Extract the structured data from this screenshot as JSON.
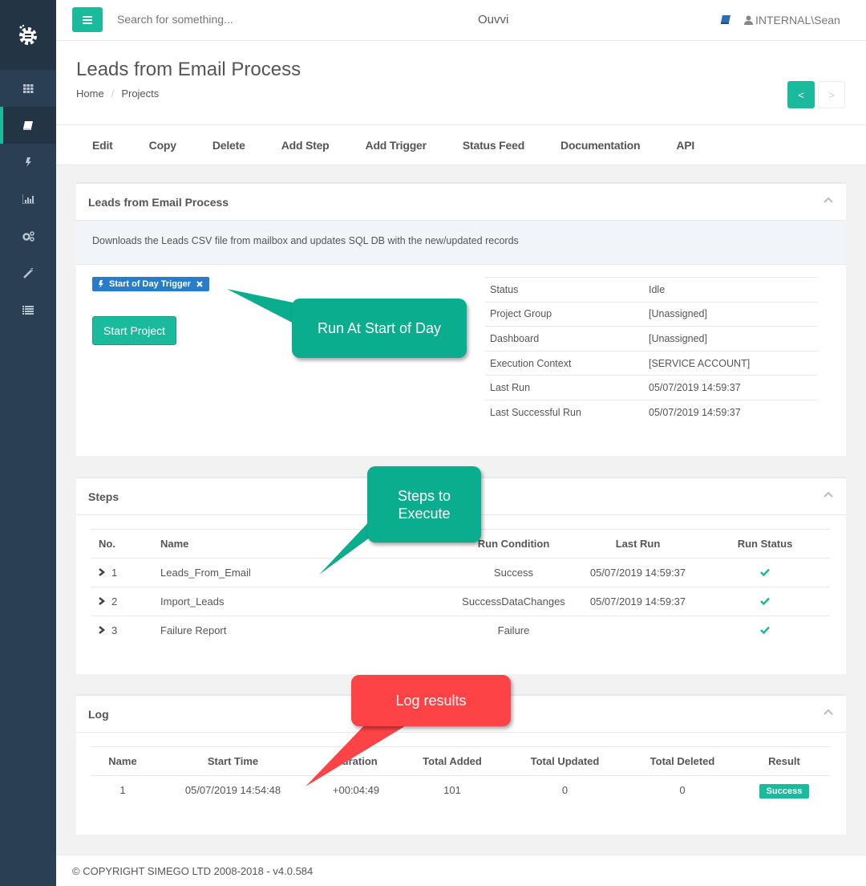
{
  "app": {
    "title": "Ouvvi"
  },
  "topbar": {
    "search_placeholder": "Search for something...",
    "user": "INTERNAL\\Sean"
  },
  "sidebar": {
    "items": [
      {
        "icon": "grid-icon",
        "active": false
      },
      {
        "icon": "book-icon",
        "active": true
      },
      {
        "icon": "bolt-icon",
        "active": false
      },
      {
        "icon": "bar-chart-icon",
        "active": false
      },
      {
        "icon": "cogs-icon",
        "active": false
      },
      {
        "icon": "magic-wand-icon",
        "active": false
      },
      {
        "icon": "list-icon",
        "active": false
      }
    ]
  },
  "page": {
    "title": "Leads from Email Process",
    "breadcrumb": [
      "Home",
      "Projects"
    ],
    "pager": {
      "prev": "<",
      "next": ">"
    }
  },
  "toolbar": {
    "items": [
      "Edit",
      "Copy",
      "Delete",
      "Add Step",
      "Add Trigger",
      "Status Feed",
      "Documentation",
      "API"
    ]
  },
  "project_panel": {
    "title": "Leads from Email Process",
    "description": "Downloads the Leads CSV file from mailbox and updates SQL DB with the new/updated records",
    "trigger": "Start of Day Trigger",
    "start_button": "Start Project",
    "info": [
      {
        "label": "Status",
        "value": "Idle"
      },
      {
        "label": "Project Group",
        "value": "[Unassigned]"
      },
      {
        "label": "Dashboard",
        "value": "[Unassigned]"
      },
      {
        "label": "Execution Context",
        "value": "[SERVICE ACCOUNT]"
      },
      {
        "label": "Last Run",
        "value": "05/07/2019 14:59:37"
      },
      {
        "label": "Last Successful Run",
        "value": "05/07/2019 14:59:37"
      }
    ]
  },
  "steps_panel": {
    "title": "Steps",
    "headers": [
      "No.",
      "Name",
      "Run Condition",
      "Last Run",
      "Run Status"
    ],
    "rows": [
      {
        "no": "1",
        "name": "Leads_From_Email",
        "condition": "Success",
        "last_run": "05/07/2019 14:59:37",
        "status": "success"
      },
      {
        "no": "2",
        "name": "Import_Leads",
        "condition": "SuccessDataChanges",
        "last_run": "05/07/2019 14:59:37",
        "status": "success"
      },
      {
        "no": "3",
        "name": "Failure Report",
        "condition": "Failure",
        "last_run": "",
        "status": "success"
      }
    ]
  },
  "log_panel": {
    "title": "Log",
    "headers": [
      "Name",
      "Start Time",
      "Duration",
      "Total Added",
      "Total Updated",
      "Total Deleted",
      "Result"
    ],
    "rows": [
      {
        "name": "1",
        "start": "05/07/2019 14:54:48",
        "duration": "+00:04:49",
        "added": "101",
        "updated": "0",
        "deleted": "0",
        "result": "Success"
      }
    ]
  },
  "callouts": {
    "trigger": "Run At Start of Day",
    "steps": "Steps to Execute",
    "log": "Log results"
  },
  "footer": {
    "text": "© COPYRIGHT SIMEGO LTD 2008-2018 - v4.0.584"
  },
  "colors": {
    "accent": "#1abb9c",
    "sidebar": "#2a3f54",
    "link": "#2a6eb8",
    "callout_green": "#0aad8d",
    "callout_red": "#fd4346"
  }
}
